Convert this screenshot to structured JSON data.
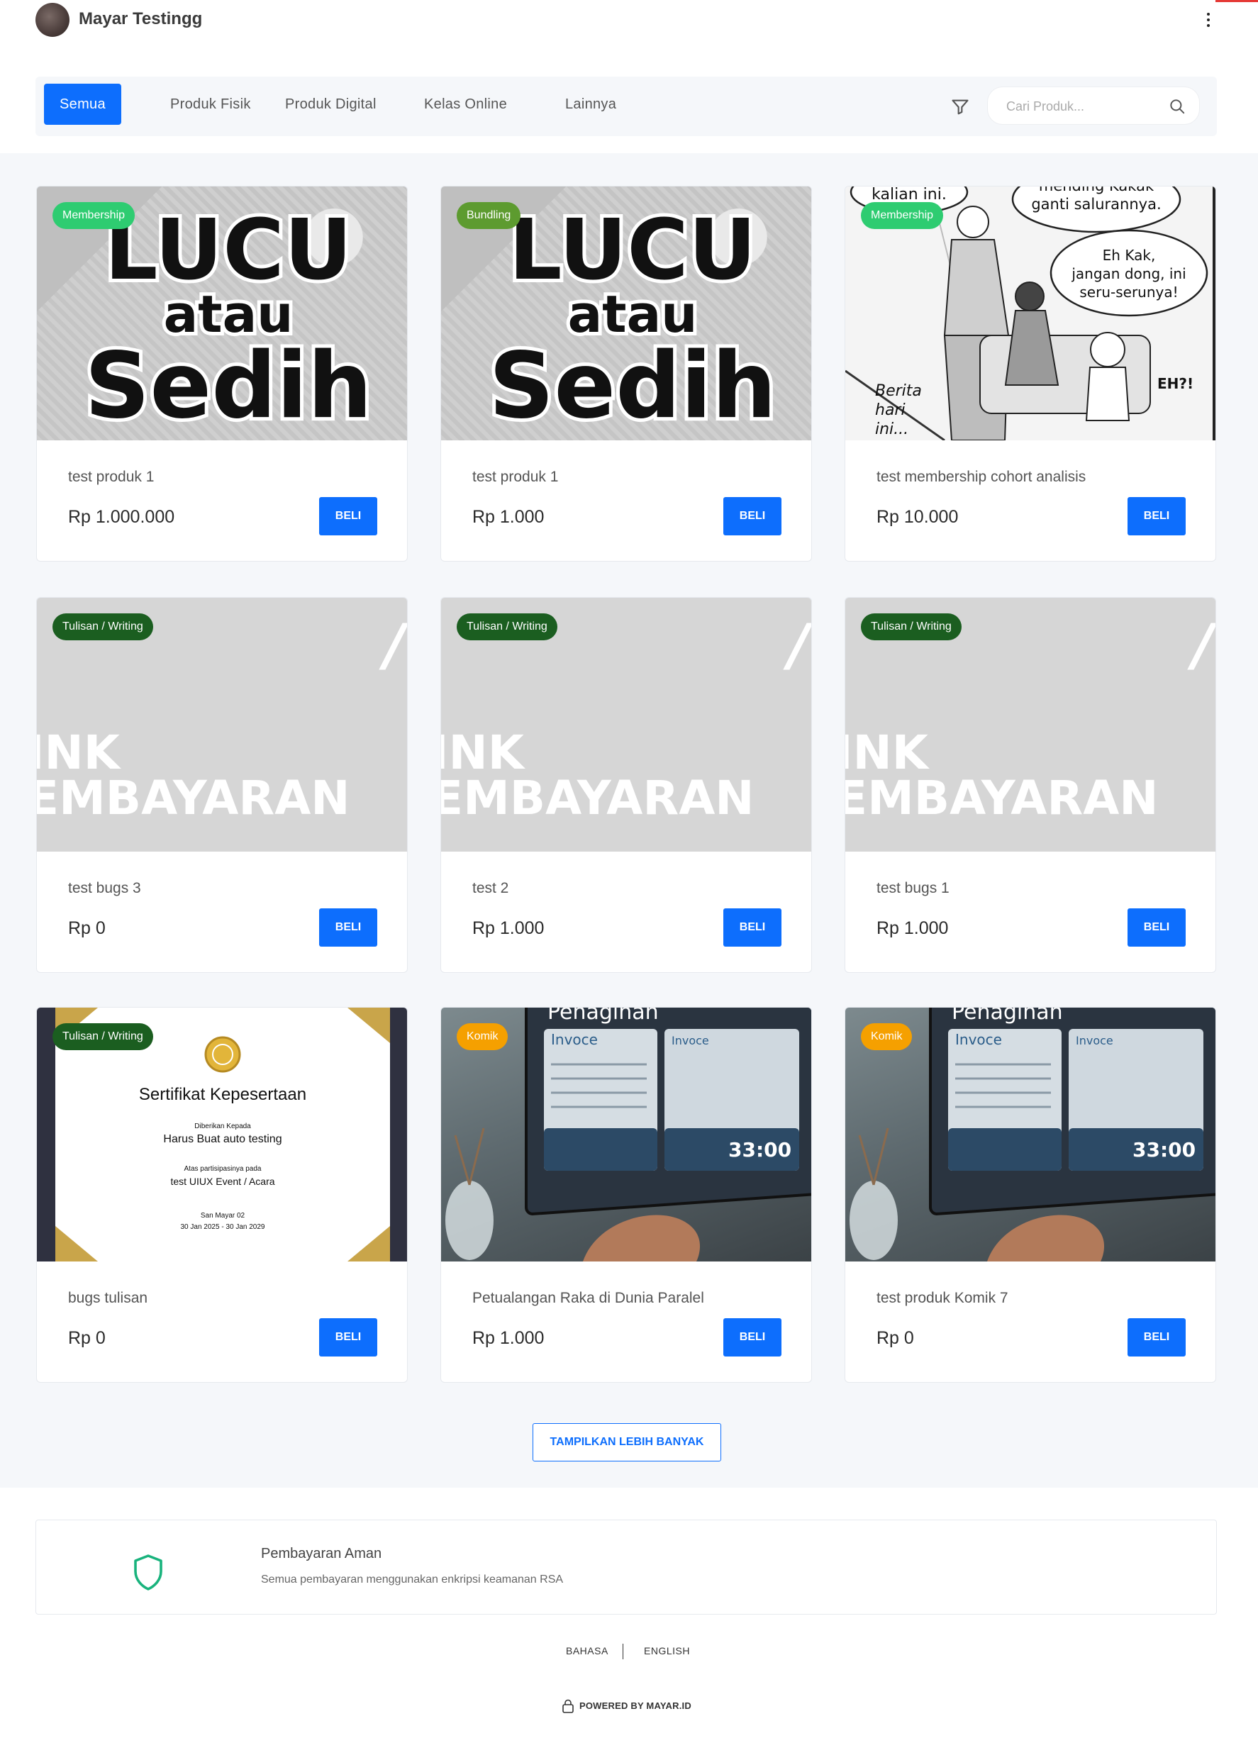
{
  "header": {
    "store_name": "Mayar Testingg"
  },
  "filter": {
    "tabs": [
      "Semua",
      "Produk Fisik",
      "Produk Digital",
      "Kelas Online",
      "Lainnya"
    ],
    "active_tab": "Semua",
    "search_placeholder": "Cari Produk..."
  },
  "colors": {
    "primary": "#0d6efd",
    "membership": "#22c55e",
    "bundling": "#5a9a2a",
    "writing": "#14532d",
    "komik": "#f59e0b"
  },
  "products": [
    {
      "badge": "Membership",
      "badge_color": "#2ecc71",
      "name": "test produk 1",
      "price": "Rp 1.000.000",
      "buy": "BELI",
      "image": "comic-cover"
    },
    {
      "badge": "Bundling",
      "badge_color": "#5d9b2f",
      "name": "test produk 1",
      "price": "Rp 1.000",
      "buy": "BELI",
      "image": "comic-cover"
    },
    {
      "badge": "Membership",
      "badge_color": "#2ecc71",
      "name": "test membership cohort analisis",
      "price": "Rp 10.000",
      "buy": "BELI",
      "image": "manga-page"
    },
    {
      "badge": "Tulisan / Writing",
      "badge_color": "#1b5e20",
      "name": "test bugs 3",
      "price": "Rp 0",
      "buy": "BELI",
      "image": "payment-link"
    },
    {
      "badge": "Tulisan / Writing",
      "badge_color": "#1b5e20",
      "name": "test 2",
      "price": "Rp 1.000",
      "buy": "BELI",
      "image": "payment-link"
    },
    {
      "badge": "Tulisan / Writing",
      "badge_color": "#1b5e20",
      "name": "test bugs 1",
      "price": "Rp 1.000",
      "buy": "BELI",
      "image": "payment-link"
    },
    {
      "badge": "Tulisan / Writing",
      "badge_color": "#1b5e20",
      "name": "bugs tulisan",
      "price": "Rp 0",
      "buy": "BELI",
      "image": "certificate"
    },
    {
      "badge": "Komik",
      "badge_color": "#f5a000",
      "name": "Petualangan Raka di Dunia Paralel",
      "price": "Rp 1.000",
      "buy": "BELI",
      "image": "invoice-screen"
    },
    {
      "badge": "Komik",
      "badge_color": "#f5a000",
      "name": "test produk Komik 7",
      "price": "Rp 0",
      "buy": "BELI",
      "image": "invoice-screen"
    }
  ],
  "thumb_text": {
    "comic": {
      "line1": "LUCU",
      "line2": "atau",
      "line3": "Sedih"
    },
    "payment": {
      "line1": "INK",
      "line2": "EMBAYARAN"
    },
    "manga": {
      "bubble1": "kalian ini.",
      "bubble2a": "mending Kakak",
      "bubble2b": "ganti salurannya.",
      "bubble3a": "Eh Kak,",
      "bubble3b": "jangan dong, ini",
      "bubble3c": "seru-serunya!",
      "caption1": "Berita",
      "caption2": "hari",
      "caption3": "ini...",
      "sfx": "EH?!"
    },
    "certificate": {
      "title": "Sertifikat Kepesertaan",
      "given_to": "Diberikan Kepada",
      "recipient": "Harus Buat auto testing",
      "for": "Atas partisipasinya pada",
      "event": "test UIUX Event / Acara",
      "signer": "San Mayar 02",
      "dates": "30 Jan 2025 - 30 Jan 2029"
    },
    "invoice": {
      "title": "Penagihan",
      "panel1": "Invoce",
      "panel2": "Invoce",
      "big_number": "33:00"
    }
  },
  "more_button": "TAMPILKAN LEBIH BANYAK",
  "footer": {
    "secure_title": "Pembayaran Aman",
    "secure_desc": "Semua pembayaran menggunakan enkripsi keamanan RSA",
    "lang_1": "BAHASA",
    "lang_2": "ENGLISH",
    "powered": "POWERED BY MAYAR.ID"
  }
}
